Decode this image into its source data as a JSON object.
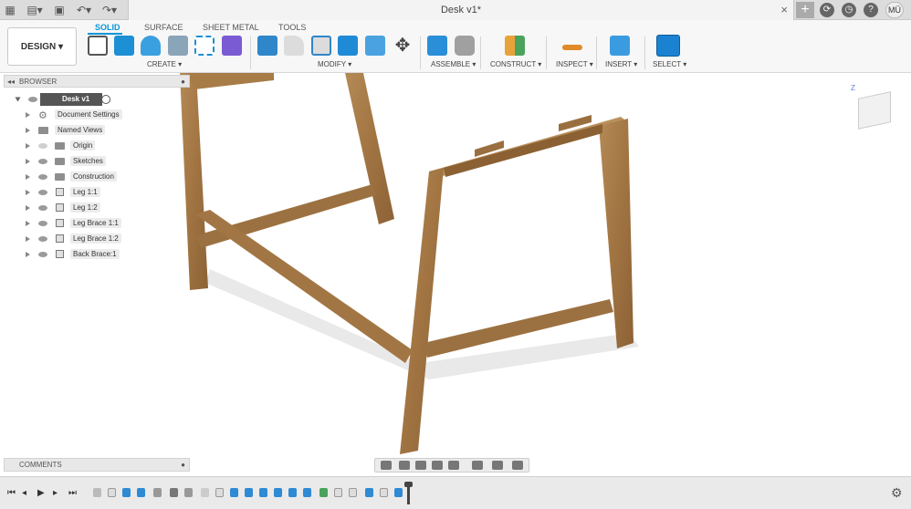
{
  "window": {
    "doc_title": "Desk v1*",
    "avatar_initials": "MÜ"
  },
  "toolbar": {
    "workspace": "DESIGN",
    "tabs": [
      "SOLID",
      "SURFACE",
      "SHEET METAL",
      "TOOLS"
    ],
    "groups": [
      "CREATE",
      "MODIFY",
      "ASSEMBLE",
      "CONSTRUCT",
      "INSPECT",
      "INSERT",
      "SELECT"
    ]
  },
  "browser": {
    "title": "BROWSER",
    "root": "Desk v1",
    "items": [
      "Document Settings",
      "Named Views",
      "Origin",
      "Sketches",
      "Construction",
      "Leg 1:1",
      "Leg 1:2",
      "Leg Brace 1:1",
      "Leg Brace 1:2",
      "Back Brace:1"
    ]
  },
  "comments": {
    "title": "COMMENTS"
  },
  "colors": {
    "accent": "#0696d7",
    "wood": "#a57a46"
  }
}
